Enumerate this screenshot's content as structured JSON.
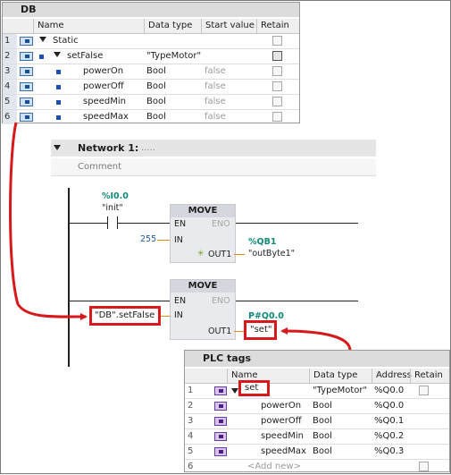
{
  "db": {
    "title": "DB",
    "columns": [
      "Name",
      "Data type",
      "Start value",
      "Retain"
    ],
    "rows": [
      {
        "num": "1",
        "name": "Static",
        "type": "",
        "start": "",
        "level": 0
      },
      {
        "num": "2",
        "name": "setFalse",
        "type": "\"TypeMotor\"",
        "start": "",
        "level": 1
      },
      {
        "num": "3",
        "name": "powerOn",
        "type": "Bool",
        "start": "false",
        "level": 2
      },
      {
        "num": "4",
        "name": "powerOff",
        "type": "Bool",
        "start": "false",
        "level": 2
      },
      {
        "num": "5",
        "name": "speedMin",
        "type": "Bool",
        "start": "false",
        "level": 2
      },
      {
        "num": "6",
        "name": "speedMax",
        "type": "Bool",
        "start": "false",
        "level": 2
      }
    ]
  },
  "network": {
    "title": "Network 1:",
    "title_dots": ".....",
    "comment": "Comment",
    "contact": {
      "address": "%I0.0",
      "tag": "\"init\""
    },
    "move1": {
      "title": "MOVE",
      "en": "EN",
      "eno": "ENO",
      "in": "IN",
      "out": "OUT1",
      "in_value": "255",
      "out_address": "%QB1",
      "out_tag": "\"outByte1\""
    },
    "move2": {
      "title": "MOVE",
      "en": "EN",
      "eno": "ENO",
      "in": "IN",
      "out": "OUT1",
      "in_value": "\"DB\".setFalse",
      "out_address": "P#Q0.0",
      "out_tag": "\"set\""
    }
  },
  "plc": {
    "title": "PLC tags",
    "columns": [
      "Name",
      "Data type",
      "Address",
      "Retain"
    ],
    "rows": [
      {
        "num": "1",
        "name": "set",
        "type": "\"TypeMotor\"",
        "address": "%Q0.0",
        "level": 0
      },
      {
        "num": "2",
        "name": "powerOn",
        "type": "Bool",
        "address": "%Q0.0",
        "level": 1
      },
      {
        "num": "3",
        "name": "powerOff",
        "type": "Bool",
        "address": "%Q0.1",
        "level": 1
      },
      {
        "num": "4",
        "name": "speedMin",
        "type": "Bool",
        "address": "%Q0.2",
        "level": 1
      },
      {
        "num": "5",
        "name": "speedMax",
        "type": "Bool",
        "address": "%Q0.3",
        "level": 1
      }
    ],
    "add_new": {
      "num": "6",
      "label": "<Add new>"
    }
  },
  "colors": {
    "highlight": "#d7191c",
    "address": "#0f8a78",
    "wire_out": "#e48b1a"
  }
}
